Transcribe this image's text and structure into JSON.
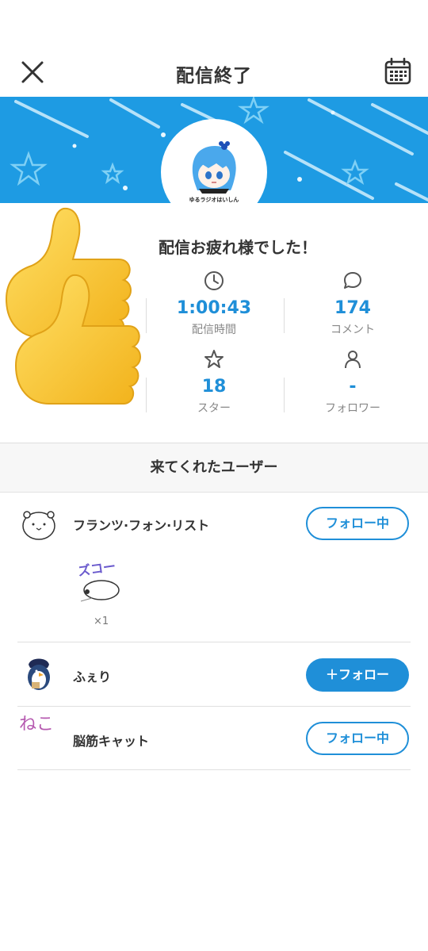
{
  "header": {
    "title": "配信終了",
    "close_icon": "close-icon",
    "calendar_icon": "calendar-icon"
  },
  "banner": {
    "avatar_caption": "ゆるラジオはいしん",
    "color": "#1e9be3"
  },
  "summary": {
    "title": "配信お疲れ様でした！",
    "stats": [
      {
        "icon": "clock-icon",
        "value": "1:00:43",
        "label": "配信時間"
      },
      {
        "icon": "comment-icon",
        "value": "174",
        "label": "コメント"
      },
      {
        "icon": "star-icon",
        "value": "18",
        "label": "スター"
      },
      {
        "icon": "person-icon",
        "value": "-",
        "label": "フォロワー"
      }
    ],
    "accent": "#1f8fd8"
  },
  "visitors": {
    "heading": "来てくれたユーザー",
    "users": [
      {
        "name": "フランツ·フォン·リスト",
        "button": "フォロー中",
        "gift_text": "ズコー",
        "gift_count": "×1"
      },
      {
        "name": "ふぇり",
        "button": "＋フォロー"
      },
      {
        "name": "脳筋キャット",
        "button": "フォロー中",
        "avatar_text": "ねこ"
      }
    ]
  }
}
